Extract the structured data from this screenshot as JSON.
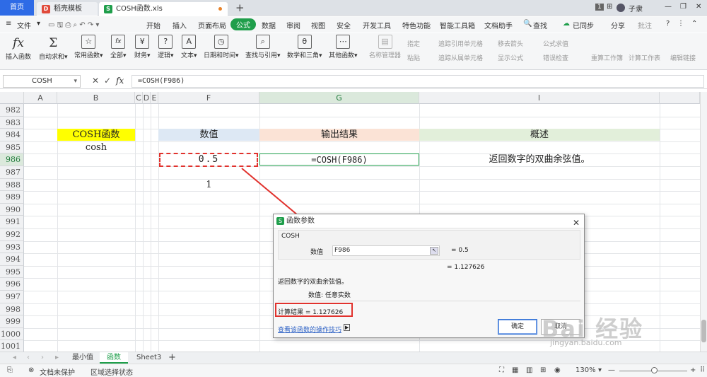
{
  "tabs": {
    "home": "首页",
    "template": "稻壳模板",
    "file": "COSH函数.xls",
    "new_tab": "+"
  },
  "titlebar": {
    "badge": "1",
    "user": "子隶"
  },
  "menu": {
    "file": "文件",
    "items": [
      "开始",
      "插入",
      "页面布局",
      "公式",
      "数据",
      "审阅",
      "视图",
      "安全",
      "开发工具",
      "特色功能",
      "智能工具箱",
      "文档助手"
    ],
    "active": "公式",
    "search": "查找",
    "sync": "已同步",
    "share": "分享",
    "comment": "批注"
  },
  "ribbon": {
    "buttons": [
      "插入函数",
      "自动求和",
      "常用函数",
      "全部",
      "财务",
      "逻辑",
      "文本",
      "日期和时间",
      "查找与引用",
      "数学和三角",
      "其他函数",
      "名称管理器"
    ],
    "small": [
      "指定",
      "粘贴",
      "追踪引用单元格",
      "追踪从属单元格",
      "移去箭头",
      "显示公式",
      "公式求值",
      "错误检查",
      "重算工作簿",
      "计算工作表",
      "编辑链接"
    ]
  },
  "formula_bar": {
    "name_box": "COSH",
    "fx": "fx",
    "content": "=COSH(F986)"
  },
  "columns": [
    "A",
    "B",
    "C",
    "D",
    "E",
    "F",
    "G",
    "I"
  ],
  "rows": [
    "982",
    "983",
    "984",
    "985",
    "986",
    "987",
    "988",
    "989",
    "990",
    "991",
    "992",
    "993",
    "994",
    "995",
    "996",
    "997",
    "998",
    "999",
    "1000",
    "1001"
  ],
  "cells": {
    "b984": "COSH函数",
    "b985": "cosh",
    "f984": "数值",
    "f986": "0.5",
    "f988": "1",
    "g984": "输出结果",
    "g986": "=COSH(F986)",
    "i984": "概述",
    "i986": "返回数字的双曲余弦值。"
  },
  "colors": {
    "yellow": "#ffff00",
    "blue": "#dde8f4",
    "orange": "#fbe3d6",
    "green": "#e2efda",
    "accent": "#1f9e4b",
    "red": "#e1322d"
  },
  "dialog": {
    "title": "函数参数",
    "func": "COSH",
    "arg_label": "数值",
    "arg_value": "F986",
    "arg_result": "= 0.5",
    "result_line": "= 1.127626",
    "description": "返回数字的双曲余弦值。",
    "param_desc": "数值:  任意实数",
    "calc_result": "计算结果 = 1.127626",
    "help_link": "查看该函数的操作技巧",
    "ok": "确定",
    "cancel": "取消"
  },
  "sheets": [
    "最小值",
    "函数",
    "Sheet3"
  ],
  "status": {
    "protect": "文档未保护",
    "region": "区域选择状态",
    "zoom": "130%"
  },
  "watermark": {
    "main": "Bai 经验",
    "sub": "jingyan.baidu.com"
  }
}
